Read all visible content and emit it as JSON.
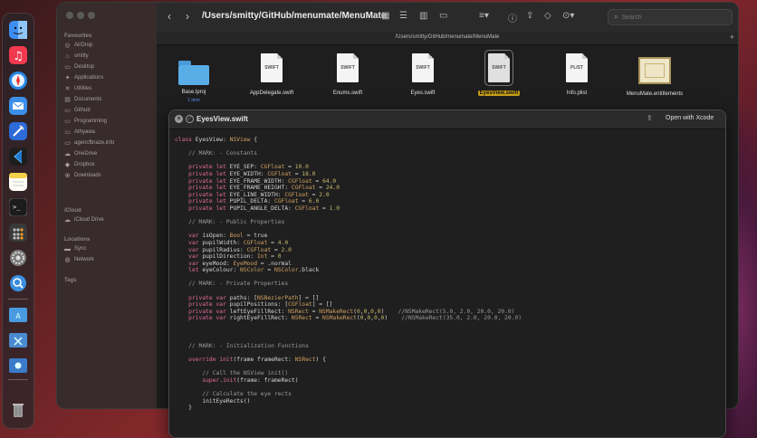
{
  "finder": {
    "path_title": "/Users/smitty/GitHub/menumate/MenuMate",
    "pathbar": "/Users/smitty/GitHub/menumate/MenuMate",
    "search_placeholder": "Search",
    "sidebar": {
      "favourites_header": "Favourites",
      "favourites": [
        {
          "label": "AirDrop",
          "icon": "airdrop-icon"
        },
        {
          "label": "smitty",
          "icon": "home-icon"
        },
        {
          "label": "Desktop",
          "icon": "desktop-icon"
        },
        {
          "label": "Applications",
          "icon": "applications-icon"
        },
        {
          "label": "Utilities",
          "icon": "utilities-icon"
        },
        {
          "label": "Documents",
          "icon": "documents-icon"
        },
        {
          "label": "Github",
          "icon": "folder-icon"
        },
        {
          "label": "Programming",
          "icon": "folder-icon"
        },
        {
          "label": "Athyawa",
          "icon": "folder-icon"
        },
        {
          "label": "agencfbraze.info",
          "icon": "folder-icon"
        },
        {
          "label": "OneDrive",
          "icon": "cloud-icon"
        },
        {
          "label": "Dropbox",
          "icon": "dropbox-icon"
        },
        {
          "label": "Downloads",
          "icon": "downloads-icon"
        }
      ],
      "icloud_header": "iCloud",
      "icloud": [
        {
          "label": "iCloud Drive",
          "icon": "icloud-icon"
        }
      ],
      "locations_header": "Locations",
      "locations": [
        {
          "label": "Sync",
          "icon": "disk-icon"
        },
        {
          "label": "Network",
          "icon": "network-icon"
        }
      ],
      "tags_header": "Tags"
    },
    "files": [
      {
        "name": "Base.lproj",
        "sub": "1 item",
        "kind": "folder"
      },
      {
        "name": "AppDelegate.swift",
        "kind": "swift"
      },
      {
        "name": "Enums.swift",
        "kind": "swift"
      },
      {
        "name": "Eyes.swift",
        "kind": "swift"
      },
      {
        "name": "EyesView.swift",
        "kind": "swift",
        "selected": true
      },
      {
        "name": "Info.plist",
        "kind": "plist"
      },
      {
        "name": "MenuMate.entitlements",
        "kind": "entitlements"
      }
    ],
    "file_badges": {
      "swift": "SWIFT",
      "plist": "PLIST"
    }
  },
  "quicklook": {
    "title": "EyesView.swift",
    "open_with": "Open with Xcode"
  },
  "code_lines": [
    "class EyesView: NSView {",
    "",
    "    // MARK: - Constants",
    "",
    "    private let EYE_SEP: CGFloat = 10.0",
    "    private let EYE_WIDTH: CGFloat = 18.0",
    "    private let EYE_FRAME_WIDTH: CGFloat = 64.0",
    "    private let EYE_FRAME_HEIGHT: CGFloat = 24.0",
    "    private let EYE_LINE_WIDTH: CGFloat = 2.0",
    "    private let PUPIL_DELTA: CGFloat = 6.0",
    "    private let PUPIL_ANGLE_DELTA: CGFloat = 1.0",
    "",
    "    // MARK: - Public Properties",
    "",
    "    var isOpen: Bool = true",
    "    var pupilWidth: CGFloat = 4.0",
    "    var pupilRadius: CGFloat = 2.0",
    "    var pupilDirection: Int = 0",
    "    var eyeMood: EyeMood = .normal",
    "    let eyeColour: NSColor = NSColor.black",
    "",
    "    // MARK: - Private Properties",
    "",
    "    private var paths: [NSBezierPath] = []",
    "    private var pupilPositions: [CGFloat] = []",
    "    private var leftEyeFillRect: NSRect = NSMakeRect(0,0,0,0)    //NSMakeRect(5.0, 2.0, 20.0, 20.0)",
    "    private var rightEyeFillRect: NSRect = NSMakeRect(0,0,0,0)    //NSMakeRect(35.0, 2.0, 20.0, 20.0)",
    "",
    "",
    "",
    "    // MARK: - Initialization Functions",
    "",
    "    override init(frame frameRect: NSRect) {",
    "",
    "        // Call the NSView init()",
    "        super.init(frame: frameRect)",
    "",
    "        // Calculate the eye rects",
    "        initEyeRects()",
    "    }"
  ],
  "dock": [
    {
      "icon": "finder-icon",
      "color": "#3d8ef0"
    },
    {
      "icon": "music-icon",
      "color": "#f2394f"
    },
    {
      "icon": "safari-icon",
      "color": "#2a88e8"
    },
    {
      "icon": "mail-icon",
      "color": "#3b8fe8"
    },
    {
      "icon": "xcode-icon",
      "color": "#2c6bd8"
    },
    {
      "icon": "vscode-icon",
      "color": "#1e7ad0"
    },
    {
      "icon": "notes-icon",
      "color": "#f4d04a"
    },
    {
      "icon": "terminal-icon",
      "color": "#1c1c1c"
    },
    {
      "icon": "calculator-icon",
      "color": "#5a5a5a"
    },
    {
      "icon": "system-settings-icon",
      "color": "#7a7a7a"
    },
    {
      "icon": "magnifier-app-icon",
      "color": "#3a8ee0"
    },
    {
      "icon": "applications-folder-icon",
      "color": "#4a9ae0"
    },
    {
      "icon": "utilities-folder-icon",
      "color": "#4a8ad0"
    },
    {
      "icon": "downloads-folder-icon",
      "color": "#3a7ac8"
    },
    {
      "icon": "trash-icon",
      "color": "#8a8a8a"
    }
  ]
}
